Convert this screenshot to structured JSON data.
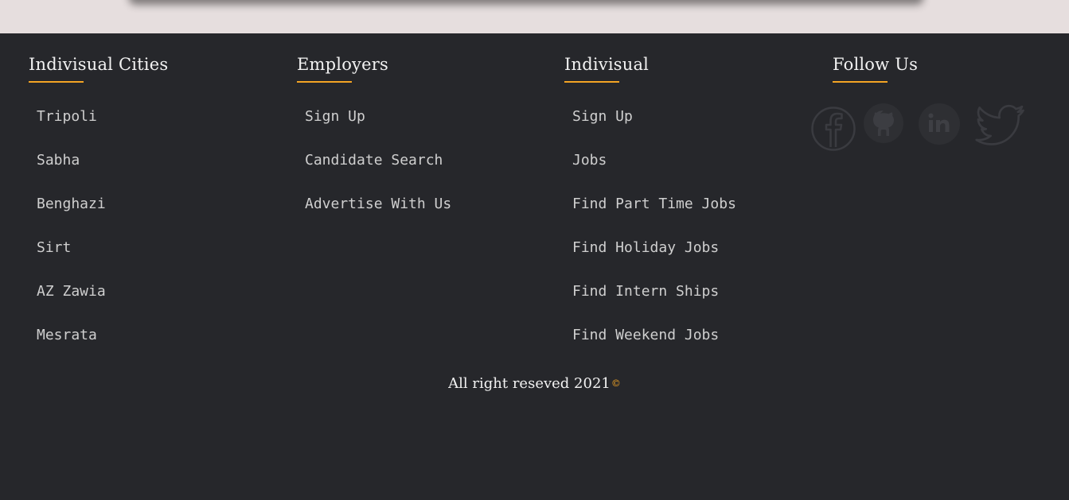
{
  "footer": {
    "columns": [
      {
        "title": "Indivisual Cities",
        "links": [
          "Tripoli",
          "Sabha",
          "Benghazi",
          "Sirt",
          "AZ Zawia",
          "Mesrata"
        ]
      },
      {
        "title": "Employers",
        "links": [
          "Sign Up",
          "Candidate Search",
          "Advertise With Us"
        ]
      },
      {
        "title": "Indivisual",
        "links": [
          "Sign Up",
          "Jobs",
          "Find Part Time Jobs",
          "Find Holiday Jobs",
          "Find Intern Ships",
          "Find Weekend Jobs"
        ]
      },
      {
        "title": "Follow Us",
        "links": []
      }
    ],
    "social_icons": [
      "facebook-icon",
      "github-icon",
      "linkedin-icon",
      "twitter-icon"
    ],
    "copyright_text": "All right reseved 2021",
    "copyright_symbol": "©",
    "colors": {
      "background": "#26272b",
      "accent": "#f3a424",
      "page_top": "#e6dede"
    }
  }
}
